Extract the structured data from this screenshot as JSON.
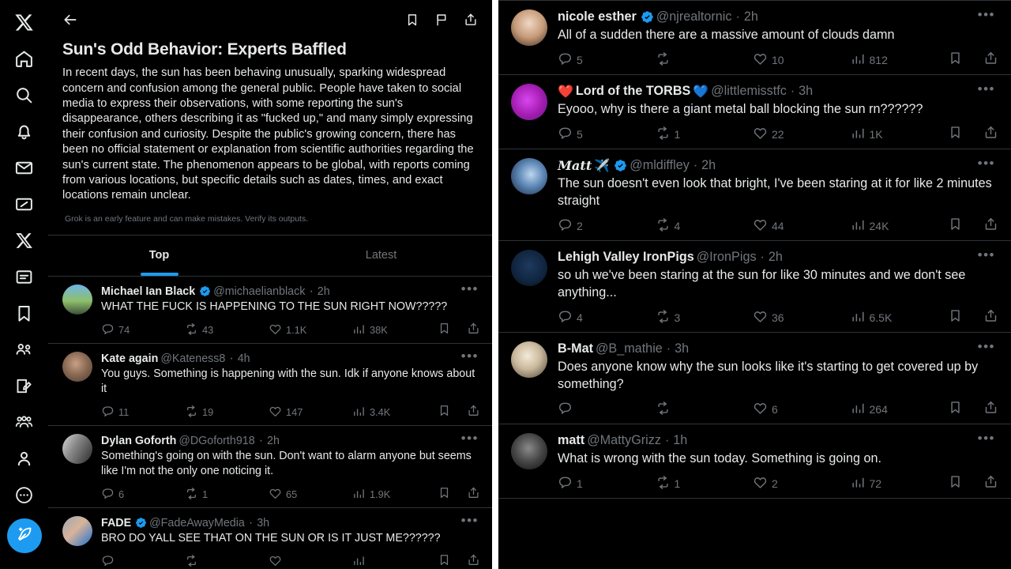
{
  "sidebar": {
    "items": [
      {
        "name": "x-logo-icon",
        "label": "X"
      },
      {
        "name": "home-icon",
        "label": "Home"
      },
      {
        "name": "search-icon",
        "label": "Explore"
      },
      {
        "name": "bell-icon",
        "label": "Notifications"
      },
      {
        "name": "mail-icon",
        "label": "Messages"
      },
      {
        "name": "grok-icon",
        "label": "Grok"
      },
      {
        "name": "x-premium-icon",
        "label": "Premium"
      },
      {
        "name": "lists-icon",
        "label": "Lists"
      },
      {
        "name": "bookmark-icon",
        "label": "Bookmarks"
      },
      {
        "name": "communities-icon",
        "label": "Communities"
      },
      {
        "name": "notes-icon",
        "label": "Notes"
      },
      {
        "name": "groups-icon",
        "label": "Groups"
      },
      {
        "name": "profile-icon",
        "label": "Profile"
      },
      {
        "name": "more-icon",
        "label": "More"
      }
    ],
    "compose_label": "Compose"
  },
  "grok_panel": {
    "back_label": "Back",
    "toolbar": {
      "bookmark_label": "Bookmark",
      "flag_label": "Report",
      "share_label": "Share"
    },
    "title": "Sun's Odd Behavior: Experts Baffled",
    "body": "In recent days, the sun has been behaving unusually, sparking widespread concern and confusion among the general public. People have taken to social media to express their observations, with some reporting the sun's disappearance, others describing it as \"fucked up,\" and many simply expressing their confusion and curiosity. Despite the public's growing concern, there has been no official statement or explanation from scientific authorities regarding the sun's current state. The phenomenon appears to be global, with reports coming from various locations, but specific details such as dates, times, and exact locations remain unclear.",
    "disclaimer": "Grok is an early feature and can make mistakes. Verify its outputs."
  },
  "tabs": [
    {
      "label": "Top",
      "active": true
    },
    {
      "label": "Latest",
      "active": false
    }
  ],
  "left_tweets": [
    {
      "name": "Michael Ian Black",
      "verified": true,
      "handle": "@michaelianblack",
      "time": "2h",
      "text": "WHAT THE FUCK IS HAPPENING TO THE SUN RIGHT NOW?????",
      "replies": "74",
      "retweets": "43",
      "likes": "1.1K",
      "views": "38K",
      "avatar_bg": "linear-gradient(180deg,#6fb4e8 0%,#8fbf6a 55%,#3c4f3a 100%)"
    },
    {
      "name": "Kate again",
      "verified": false,
      "handle": "@Kateness8",
      "time": "4h",
      "text": "You guys. Something is happening with the sun. Idk if anyone knows about it",
      "replies": "11",
      "retweets": "19",
      "likes": "147",
      "views": "3.4K",
      "avatar_bg": "radial-gradient(circle at 45% 40%, #c9a086 0%, #8c6b55 45%, #4a3a2e 100%)"
    },
    {
      "name": "Dylan Goforth",
      "verified": false,
      "handle": "@DGoforth918",
      "time": "2h",
      "text": "Something's going on with the sun. Don't want to alarm anyone but seems like I'm not the only one noticing it.",
      "replies": "6",
      "retweets": "1",
      "likes": "65",
      "views": "1.9K",
      "avatar_bg": "linear-gradient(120deg,#d8d8d8 0%,#8a8a8a 40%,#2a2a2a 100%)"
    },
    {
      "name": "FADE",
      "verified": true,
      "handle": "@FadeAwayMedia",
      "time": "3h",
      "text": "BRO DO YALL SEE THAT ON THE SUN OR IS IT JUST ME??????",
      "replies": "",
      "retweets": "",
      "likes": "",
      "views": "",
      "avatar_bg": "linear-gradient(135deg,#9aa7b5 0%,#d8b49a 45%,#1d6fd0 100%)"
    }
  ],
  "right_tweets": [
    {
      "name": "nicole esther",
      "name_prefix_emoji": "",
      "name_suffix_emoji": "",
      "verified": true,
      "handle": "@njrealtornic",
      "time": "2h",
      "text": "All of a sudden there are a massive amount of clouds damn",
      "replies": "5",
      "retweets": "",
      "likes": "10",
      "views": "812",
      "avatar_bg": "radial-gradient(circle at 50% 38%, #f0d8c4 0%, #c59a78 50%, #3b2a20 100%)"
    },
    {
      "name": "Lord of the TORBS",
      "name_prefix_emoji": "❤️",
      "name_suffix_emoji": "💙",
      "verified": false,
      "handle": "@littlemisstfc",
      "time": "3h",
      "text": "Eyooo, why is there a giant metal ball blocking the sun rn??????",
      "replies": "5",
      "retweets": "1",
      "likes": "22",
      "views": "1K",
      "avatar_bg": "radial-gradient(circle at 45% 45%, #d946ef 0%, #a21caf 55%, #581c87 100%)"
    },
    {
      "name": "Matt",
      "name_prefix_emoji": "",
      "name_suffix_emoji": "✈️",
      "name_style": "script",
      "verified": true,
      "handle": "@mldiffley",
      "time": "2h",
      "text": "The sun doesn't even look that bright, I've been staring at it for like 2 minutes straight",
      "replies": "2",
      "retweets": "4",
      "likes": "44",
      "views": "24K",
      "avatar_bg": "radial-gradient(circle at 55% 45%, #bcd6ef 0%, #5d86b5 45%, #13233a 100%)"
    },
    {
      "name": "Lehigh Valley IronPigs",
      "name_prefix_emoji": "",
      "name_suffix_emoji": "",
      "verified": false,
      "handle": "@IronPigs",
      "time": "2h",
      "text": "so uh we've been staring at the sun for like 30 minutes and we don't see anything...",
      "replies": "4",
      "retweets": "3",
      "likes": "36",
      "views": "6.5K",
      "avatar_bg": "radial-gradient(circle at 50% 45%, #1e3a5f 0%, #10243d 60%, #060c16 100%)"
    },
    {
      "name": "B-Mat",
      "name_prefix_emoji": "",
      "name_suffix_emoji": "",
      "verified": false,
      "handle": "@B_mathie",
      "time": "3h",
      "text": "Does anyone know why the sun looks like it's starting to get covered up by something?",
      "replies": "",
      "retweets": "",
      "likes": "6",
      "views": "264",
      "avatar_bg": "radial-gradient(circle at 45% 40%, #f5ead9 0%, #c9b89c 45%, #4a4036 100%)"
    },
    {
      "name": "matt",
      "name_prefix_emoji": "",
      "name_suffix_emoji": "",
      "verified": false,
      "handle": "@MattyGrizz",
      "time": "1h",
      "text": "What is wrong with the sun today. Something is going on.",
      "replies": "1",
      "retweets": "1",
      "likes": "2",
      "views": "72",
      "avatar_bg": "radial-gradient(circle at 48% 42%, #8a8a8a 0%, #454545 50%, #101010 100%)"
    }
  ],
  "colors": {
    "accent": "#1d9bf0",
    "verified_blue": "#1d9bf0",
    "text_primary": "#e7e9ea",
    "text_secondary": "#71767b",
    "border": "#2f3336",
    "background": "#000000"
  }
}
